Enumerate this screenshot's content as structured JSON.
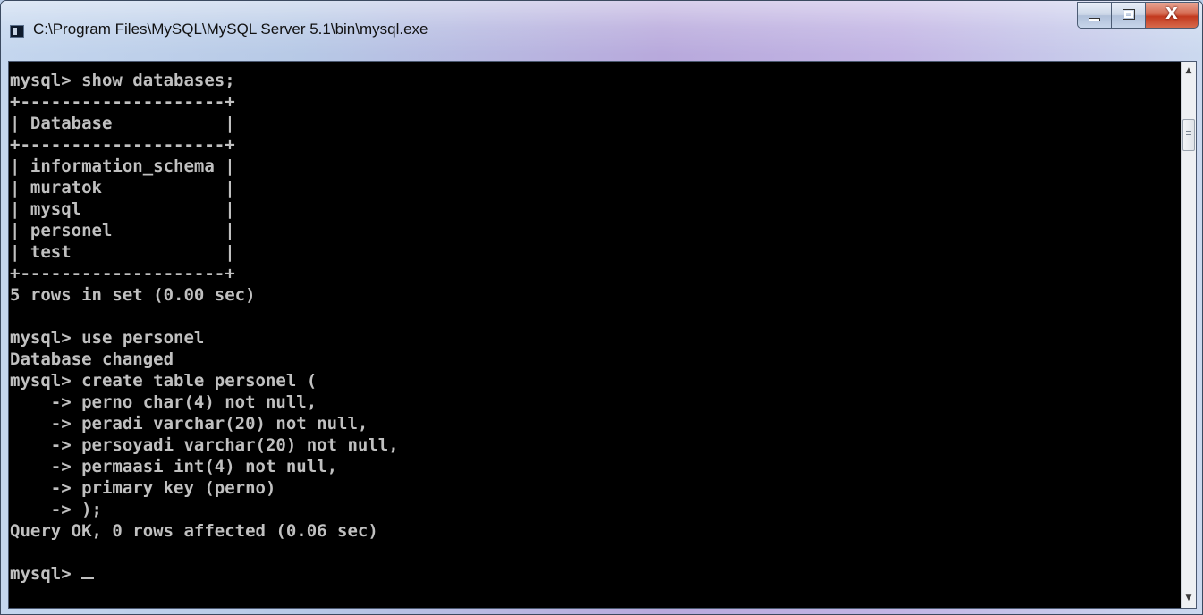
{
  "window": {
    "title": "C:\\Program Files\\MySQL\\MySQL Server 5.1\\bin\\mysql.exe",
    "buttons": {
      "minimize_glyph": "▬",
      "maximize_glyph": "☐",
      "close_glyph": "X"
    }
  },
  "console": {
    "lines": [
      "mysql> show databases;",
      "+--------------------+",
      "| Database           |",
      "+--------------------+",
      "| information_schema |",
      "| muratok            |",
      "| mysql              |",
      "| personel           |",
      "| test               |",
      "+--------------------+",
      "5 rows in set (0.00 sec)",
      "",
      "mysql> use personel",
      "Database changed",
      "mysql> create table personel (",
      "    -> perno char(4) not null,",
      "    -> peradi varchar(20) not null,",
      "    -> persoyadi varchar(20) not null,",
      "    -> permaasi int(4) not null,",
      "    -> primary key (perno)",
      "    -> );",
      "Query OK, 0 rows affected (0.06 sec)",
      "",
      "mysql> "
    ]
  },
  "scrollbar": {
    "up_arrow": "▲",
    "down_arrow": "▼"
  },
  "colors": {
    "console_background": "#000000",
    "console_text": "#c0c0c0",
    "close_button": "#c2391e"
  }
}
